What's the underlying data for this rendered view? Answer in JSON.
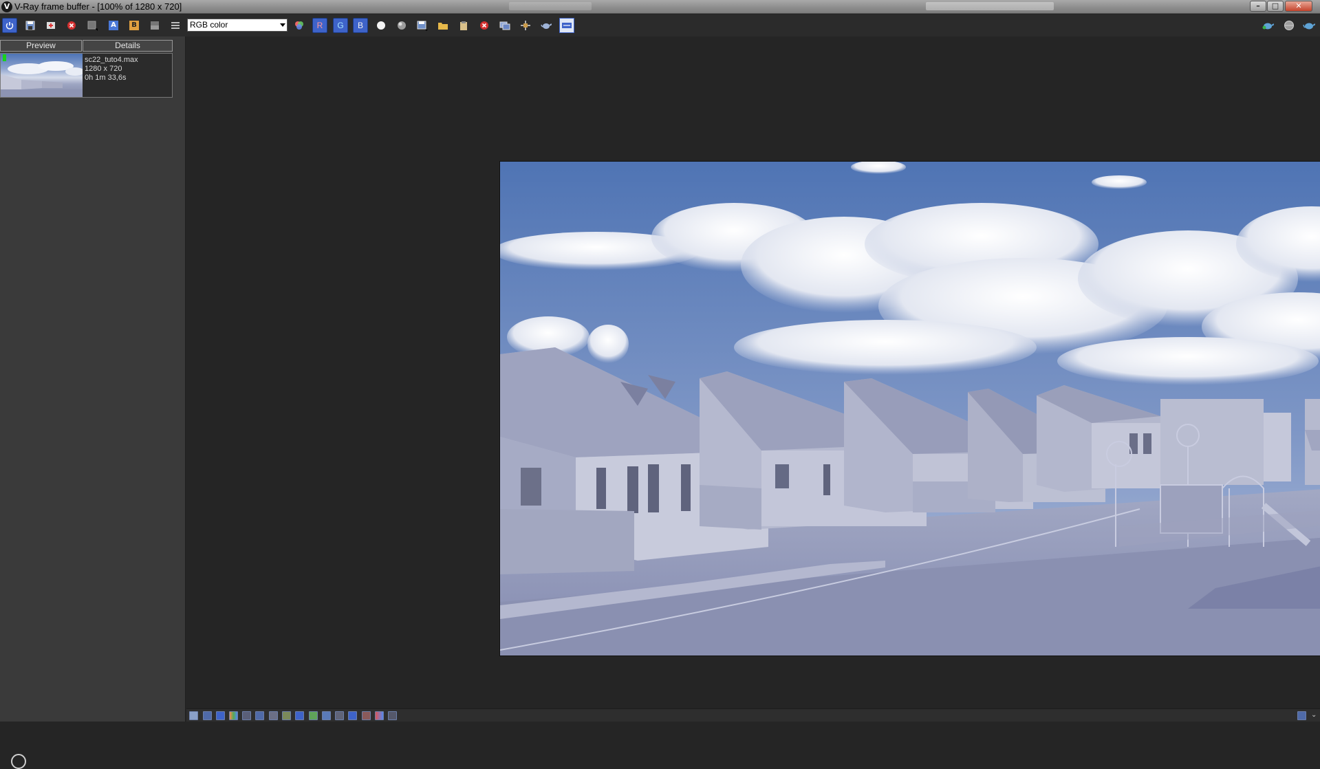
{
  "window": {
    "title": "V-Ray frame buffer - [100% of 1280 x 720]",
    "controls": [
      "minimize",
      "maximize",
      "close"
    ]
  },
  "toolbar": {
    "channel_select": "RGB color",
    "buttons": [
      {
        "name": "track-mouse-button",
        "icon": "power-icon"
      },
      {
        "name": "save-image-button",
        "icon": "save-icon"
      },
      {
        "name": "save-all-button",
        "icon": "save-all-icon"
      },
      {
        "name": "clear-image-button",
        "icon": "stop-icon"
      },
      {
        "name": "region-render-button",
        "icon": "region-icon"
      },
      {
        "name": "compare-a-button",
        "label": "A"
      },
      {
        "name": "compare-b-button",
        "label": "B"
      },
      {
        "name": "ab-horizontal-button",
        "icon": "ab-icon"
      },
      {
        "name": "menu-button",
        "icon": "menu-icon"
      },
      {
        "name": "color-corrections-button",
        "icon": "color-circles-icon"
      },
      {
        "name": "red-channel-button",
        "label": "R"
      },
      {
        "name": "green-channel-button",
        "label": "G"
      },
      {
        "name": "blue-channel-button",
        "label": "B"
      },
      {
        "name": "alpha-channel-button",
        "icon": "white-sphere-icon"
      },
      {
        "name": "monochrome-button",
        "icon": "gray-sphere-icon"
      },
      {
        "name": "save-history-button",
        "icon": "disk-icon"
      },
      {
        "name": "load-image-button",
        "icon": "folder-icon"
      },
      {
        "name": "copy-clipboard-button",
        "icon": "clipboard-icon"
      },
      {
        "name": "stop-render-button",
        "icon": "stop-icon"
      },
      {
        "name": "show-corrections-button",
        "icon": "monitor-icon"
      },
      {
        "name": "pixel-info-button",
        "icon": "crosshair-icon"
      },
      {
        "name": "render-last-button",
        "icon": "teapot-icon"
      },
      {
        "name": "lens-effects-button",
        "icon": "lens-icon"
      },
      {
        "name": "interactive-render-button",
        "icon": "teapot-blue-icon"
      },
      {
        "name": "lock-button",
        "icon": "sphere-icon"
      },
      {
        "name": "render-button",
        "icon": "teapot-render-icon"
      }
    ]
  },
  "history": {
    "tabs": [
      "Preview",
      "Details"
    ],
    "items": [
      {
        "file": "sc22_tuto4.max",
        "resolution": "1280 x 720",
        "render_time": "0h 1m 33,6s"
      }
    ]
  },
  "render": {
    "description": "Rendered scene of white clay-material houses with a playground under a cloudy blue sky"
  },
  "colors": {
    "sky_top": "#5277b7",
    "sky_horizon": "#a9b7d6",
    "ground": "#8e95b4",
    "house": "#aeb2c8",
    "accent_button": "#3e63c9"
  },
  "statusbar": {
    "icons": [
      "image-info-icon",
      "exposure-icon",
      "histogram-icon",
      "levels-icon",
      "curve-icon",
      "bg-image-icon",
      "lut-icon",
      "ocio-icon",
      "icc-icon",
      "display-correction-icon",
      "linear-icon",
      "srgb-icon",
      "stamp-icon",
      "lens-icon",
      "filter-icon",
      "history-icon",
      "settings-icon"
    ]
  }
}
